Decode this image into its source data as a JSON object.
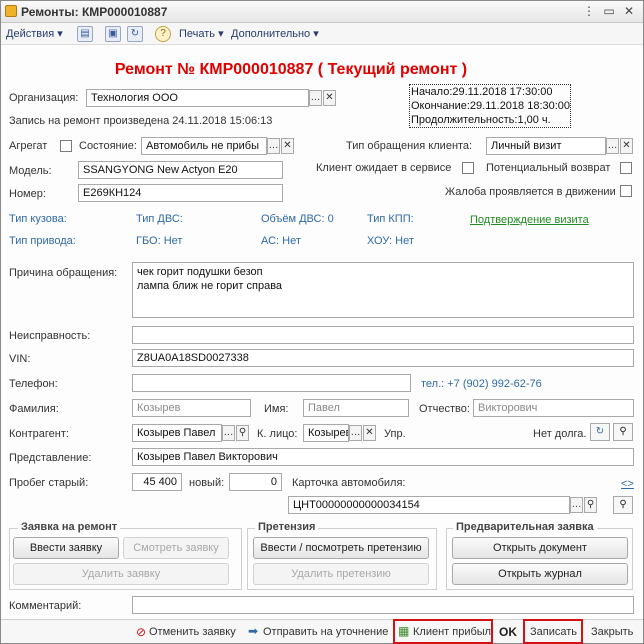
{
  "window": {
    "title": "Ремонты: КМР000010887"
  },
  "toolbar": {
    "actions": "Действия",
    "print": "Печать",
    "additional": "Дополнительно",
    "help_icon": "?"
  },
  "doc_title": "Ремонт № КМР000010887 ( Текущий ремонт )",
  "time": {
    "start": "Начало:29.11.2018 17:30:00",
    "end": "Окончание:29.11.2018 18:30:00",
    "duration": "Продолжительность:1,00 ч."
  },
  "org": {
    "label": "Организация:",
    "value": "Технология ООО"
  },
  "record_note": "Запись на ремонт произведена 24.11.2018 15:06:13",
  "aggregate": {
    "label": "Агрегат"
  },
  "state": {
    "label": "Состояние:",
    "value": "Автомобиль не прибы"
  },
  "appeal_type": {
    "label": "Тип обращения клиента:",
    "value": "Личный визит"
  },
  "model": {
    "label": "Модель:",
    "value": "SSANGYONG New Actyon E20"
  },
  "client_waits": {
    "label": "Клиент ожидает в сервисе"
  },
  "potential_return": {
    "label": "Потенциальный возврат"
  },
  "number": {
    "label": "Номер:",
    "value": "Е269КН124"
  },
  "complaint_motion": {
    "label": "Жалоба проявляется в движении"
  },
  "specs": {
    "body": "Тип кузова:",
    "engine": "Тип ДВС:",
    "volume": "Объём ДВС: 0",
    "gearbox": "Тип КПП:",
    "drive": "Тип привода:",
    "gbo": "ГБО: Нет",
    "ac": "АС: Нет",
    "hou": "ХОУ: Нет"
  },
  "visit_confirm": "Подтверждение визита",
  "reason": {
    "label": "Причина обращения:",
    "line1": "чек горит подушки безоп",
    "line2": "лампа ближ не горит справа"
  },
  "malfunction": {
    "label": "Неисправность:",
    "value": ""
  },
  "vin": {
    "label": "VIN:",
    "value": "Z8UA0A18SD0027338"
  },
  "phone": {
    "label": "Телефон:",
    "value": "",
    "link": "тел.: +7 (902) 992-62-76"
  },
  "surname": {
    "label": "Фамилия:",
    "value": "Козырев"
  },
  "name": {
    "label": "Имя:",
    "value": "Павел"
  },
  "patronymic": {
    "label": "Отчество:",
    "value": "Викторович"
  },
  "counterparty": {
    "label": "Контрагент:",
    "value": "Козырев Павел"
  },
  "person": {
    "label": "К. лицо:",
    "value": "Козырев"
  },
  "manage": {
    "label": "Упр."
  },
  "no_debt": "Нет долга.",
  "representation": {
    "label": "Представление:",
    "value": "Козырев Павел Викторович"
  },
  "mileage_old": {
    "label": "Пробег старый:",
    "value": "45 400"
  },
  "mileage_new": {
    "label": "новый:",
    "value": "0"
  },
  "car_card": {
    "label": "Карточка автомобиля:",
    "value": "ЦНТ00000000000034154",
    "link": "<>"
  },
  "group_order": {
    "title": "Заявка на ремонт",
    "enter": "Ввести заявку",
    "view": "Смотреть заявку",
    "delete": "Удалить заявку"
  },
  "group_claim": {
    "title": "Претензия",
    "enter": "Ввести / посмотреть претензию",
    "delete": "Удалить претензию"
  },
  "group_pre": {
    "title": "Предварительная заявка",
    "open_doc": "Открыть документ",
    "open_journal": "Открыть журнал"
  },
  "comment": {
    "label": "Комментарий:",
    "value": ""
  },
  "bottom": {
    "cancel": "Отменить заявку",
    "send": "Отправить на уточнение",
    "arrived": "Клиент прибыл",
    "ok": "OK",
    "save": "Записать",
    "close": "Закрыть"
  },
  "colors": {
    "title_red": "#e00000",
    "link_blue": "#2f6aa5",
    "link_green": "#218a21",
    "highlight_red": "#d41212"
  }
}
